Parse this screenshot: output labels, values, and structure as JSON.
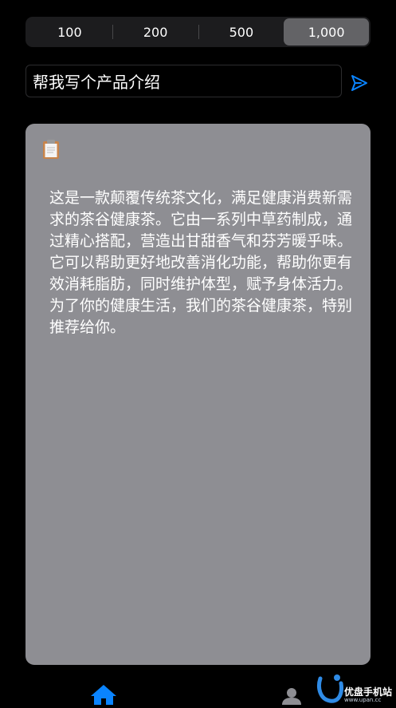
{
  "length_selector": {
    "options": [
      "100",
      "200",
      "500",
      "1,000"
    ],
    "selected": "1,000"
  },
  "prompt": {
    "value": "帮我写个产品介绍"
  },
  "result": {
    "text": "这是一款颠覆传统茶文化，满足健康消费新需求的茶谷健康茶。它由一系列中草药制成，通过精心搭配，营造出甘甜香气和芬芳暖乎味。它可以帮助更好地改善消化功能，帮助你更有效消耗脂肪，同时维护体型，赋予身体活力。为了你的健康生活，我们的茶谷健康茶，特别推荐给你。"
  },
  "icons": {
    "send": "send-icon",
    "copy": "clipboard-icon",
    "home": "home-icon",
    "profile": "person-icon"
  },
  "watermark": {
    "title": "优盘手机站",
    "url": "www.upan.cc"
  },
  "colors": {
    "accent": "#0a84ff",
    "card": "#8e8e93",
    "background": "#000000",
    "segment_selected": "#636366"
  }
}
